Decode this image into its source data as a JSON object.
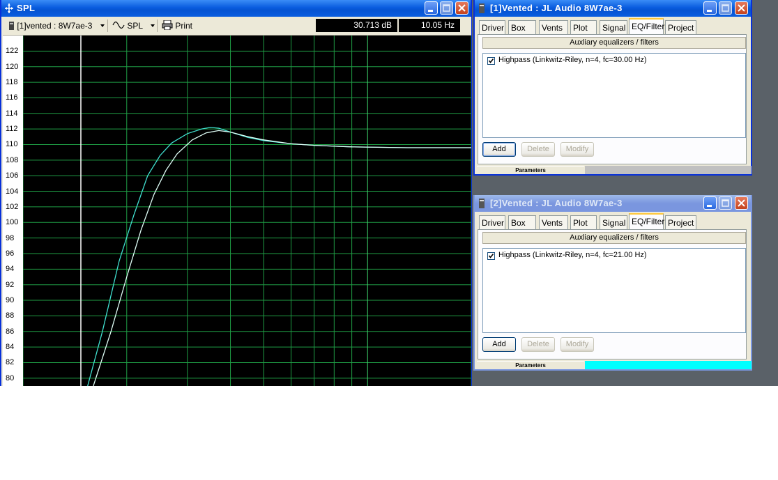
{
  "spl_window": {
    "title": "SPL",
    "toolbar": {
      "project_select": "[1]vented : 8W7ae-3",
      "curve_select": "SPL",
      "print_label": "Print",
      "readout_db": "30.713 dB",
      "readout_hz": "10.05 Hz"
    },
    "y_ticks": [
      "122",
      "120",
      "118",
      "116",
      "114",
      "112",
      "110",
      "108",
      "106",
      "104",
      "102",
      "100",
      "98",
      "96",
      "94",
      "92",
      "90",
      "88",
      "86",
      "84",
      "82",
      "80"
    ]
  },
  "chart_data": {
    "type": "line",
    "ylim": [
      79,
      124
    ],
    "x_scale": "log",
    "xlim": [
      10,
      200
    ],
    "grid": true,
    "series": [
      {
        "color": "#40e0d0",
        "points": [
          [
            15.4,
            79
          ],
          [
            17,
            86
          ],
          [
            19,
            95
          ],
          [
            21,
            101
          ],
          [
            23,
            106
          ],
          [
            25,
            108.6
          ],
          [
            27,
            110.2
          ],
          [
            30,
            111.4
          ],
          [
            33,
            112
          ],
          [
            35,
            112.2
          ],
          [
            37,
            112.1
          ],
          [
            40,
            111.6
          ],
          [
            45,
            110.9
          ],
          [
            50,
            110.5
          ],
          [
            60,
            110.1
          ],
          [
            70,
            109.9
          ],
          [
            90,
            109.7
          ],
          [
            130,
            109.6
          ],
          [
            200,
            109.6
          ]
        ]
      },
      {
        "color": "#e0fff8",
        "points": [
          [
            16,
            79
          ],
          [
            18,
            86
          ],
          [
            20,
            93
          ],
          [
            22,
            99
          ],
          [
            24,
            103.6
          ],
          [
            26,
            106.7
          ],
          [
            28,
            108.8
          ],
          [
            31,
            110.6
          ],
          [
            34,
            111.5
          ],
          [
            37,
            111.8
          ],
          [
            40,
            111.6
          ],
          [
            45,
            111
          ],
          [
            50,
            110.6
          ],
          [
            60,
            110.1
          ],
          [
            70,
            109.9
          ],
          [
            90,
            109.7
          ],
          [
            130,
            109.6
          ],
          [
            200,
            109.6
          ]
        ]
      }
    ]
  },
  "dialog1": {
    "title": "[1]Vented : JL Audio 8W7ae-3",
    "tabs": [
      "Driver",
      "Box",
      "Vents",
      "Plot",
      "Signal",
      "EQ/Filter",
      "Project"
    ],
    "active_tab": "EQ/Filter",
    "aux_button": "Auxliary equalizers / filters",
    "filter_item": "Highpass (Linkwitz-Riley, n=4, fc=30.00 Hz)",
    "filter_checked": true,
    "add_label": "Add",
    "delete_label": "Delete",
    "modify_label": "Modify",
    "params_label": "Parameters",
    "params_bar_color": "#c0c0c0"
  },
  "dialog2": {
    "title": "[2]Vented : JL Audio 8W7ae-3",
    "tabs": [
      "Driver",
      "Box",
      "Vents",
      "Plot",
      "Signal",
      "EQ/Filter",
      "Project"
    ],
    "active_tab": "EQ/Filter",
    "aux_button": "Auxliary equalizers / filters",
    "filter_item": "Highpass (Linkwitz-Riley, n=4, fc=21.00 Hz)",
    "filter_checked": true,
    "add_label": "Add",
    "delete_label": "Delete",
    "modify_label": "Modify",
    "params_label": "Parameters",
    "params_bar_color": "#00ffff"
  }
}
